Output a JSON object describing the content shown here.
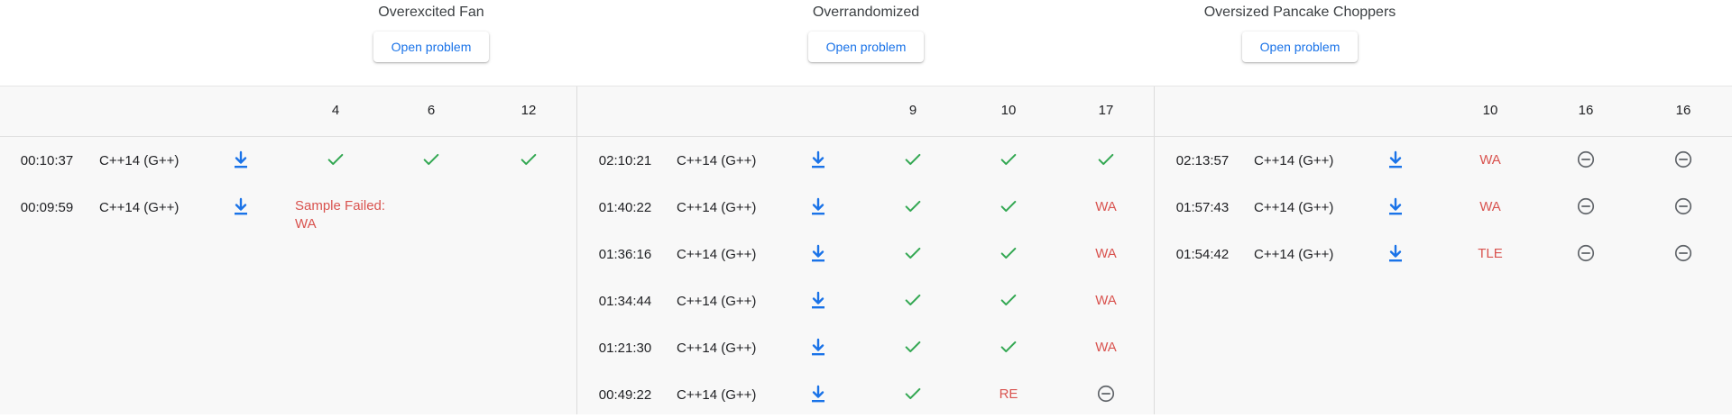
{
  "problems": [
    {
      "title": "Overexcited Fan",
      "open_label": "Open problem",
      "tests": [
        "4",
        "6",
        "12"
      ],
      "submissions": [
        {
          "time": "00:10:37",
          "lang": "C++14 (G++)",
          "results": [
            "ok",
            "ok",
            "ok"
          ]
        },
        {
          "time": "00:09:59",
          "lang": "C++14 (G++)",
          "sample_failed": "Sample Failed:\nWA"
        }
      ]
    },
    {
      "title": "Overrandomized",
      "open_label": "Open problem",
      "tests": [
        "9",
        "10",
        "17"
      ],
      "submissions": [
        {
          "time": "02:10:21",
          "lang": "C++14 (G++)",
          "results": [
            "ok",
            "ok",
            "ok"
          ]
        },
        {
          "time": "01:40:22",
          "lang": "C++14 (G++)",
          "results": [
            "ok",
            "ok",
            "WA"
          ]
        },
        {
          "time": "01:36:16",
          "lang": "C++14 (G++)",
          "results": [
            "ok",
            "ok",
            "WA"
          ]
        },
        {
          "time": "01:34:44",
          "lang": "C++14 (G++)",
          "results": [
            "ok",
            "ok",
            "WA"
          ]
        },
        {
          "time": "01:21:30",
          "lang": "C++14 (G++)",
          "results": [
            "ok",
            "ok",
            "WA"
          ]
        },
        {
          "time": "00:49:22",
          "lang": "C++14 (G++)",
          "results": [
            "ok",
            "RE",
            "skip"
          ]
        }
      ]
    },
    {
      "title": "Oversized Pancake Choppers",
      "open_label": "Open problem",
      "tests": [
        "10",
        "16",
        "16"
      ],
      "submissions": [
        {
          "time": "02:13:57",
          "lang": "C++14 (G++)",
          "results": [
            "WA",
            "skip",
            "skip"
          ]
        },
        {
          "time": "01:57:43",
          "lang": "C++14 (G++)",
          "results": [
            "WA",
            "skip",
            "skip"
          ]
        },
        {
          "time": "01:54:42",
          "lang": "C++14 (G++)",
          "results": [
            "TLE",
            "skip",
            "skip"
          ]
        }
      ]
    }
  ],
  "icons": {
    "ok": "check-icon",
    "skip": "minus-circle-icon",
    "download": "download-icon"
  },
  "colors": {
    "ok": "#34a853",
    "fail": "#d9534f",
    "link": "#1a73e8",
    "skip": "#5f6368"
  }
}
